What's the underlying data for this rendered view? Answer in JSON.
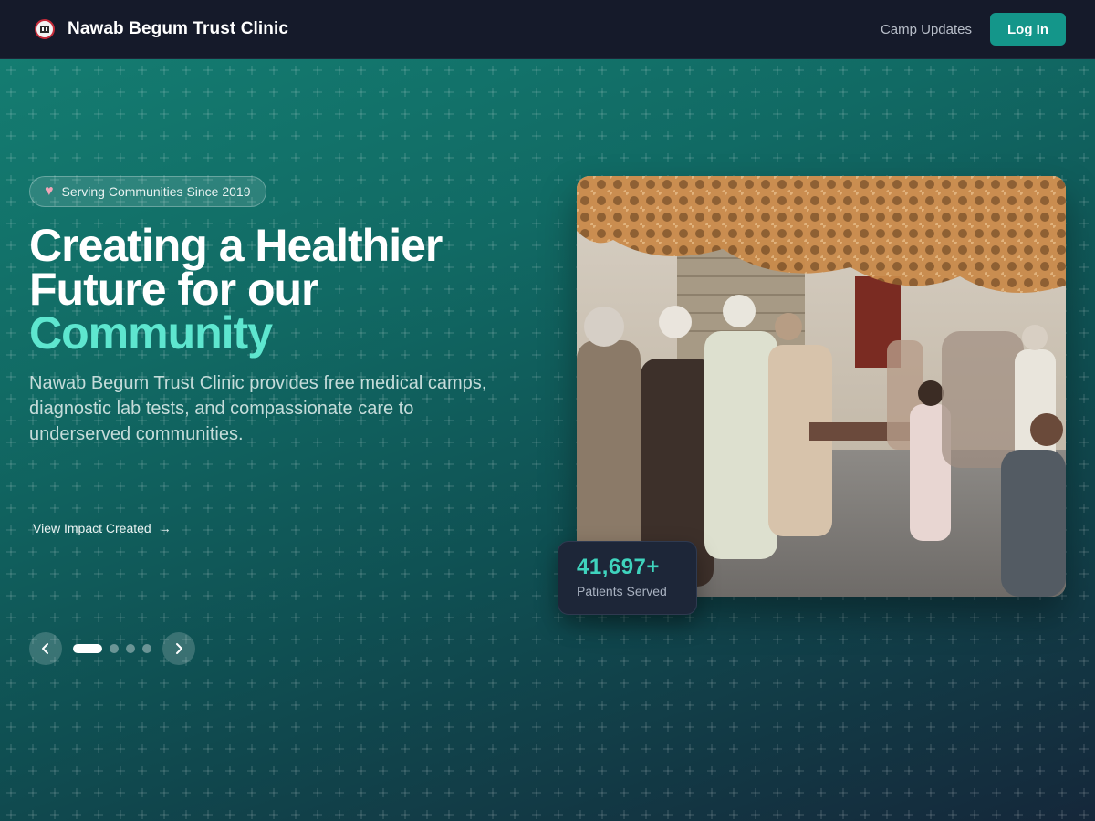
{
  "header": {
    "brand": "Nawab Begum Trust Clinic",
    "logo_icon": "clinic-logo-icon",
    "nav_link": "Camp Updates",
    "login_label": "Log In"
  },
  "hero": {
    "badge": "Serving Communities Since 2019",
    "badge_icon": "heart-icon",
    "headline_line1": "Creating a Healthier",
    "headline_line2": "Future for our",
    "headline_accent": "Community",
    "subtext": "Nawab Begum Trust Clinic provides free medical camps, diagnostic lab tests, and compassionate care to underserved communities.",
    "impact_link": "View Impact Created",
    "carousel": {
      "slides": 4,
      "active_index": 0
    }
  },
  "stat": {
    "value": "41,697+",
    "label": "Patients Served"
  },
  "colors": {
    "nav_bg": "#151a2a",
    "accent": "#14968a",
    "headline_accent": "#5ee6cf",
    "stat_value": "#3fd3bd"
  }
}
